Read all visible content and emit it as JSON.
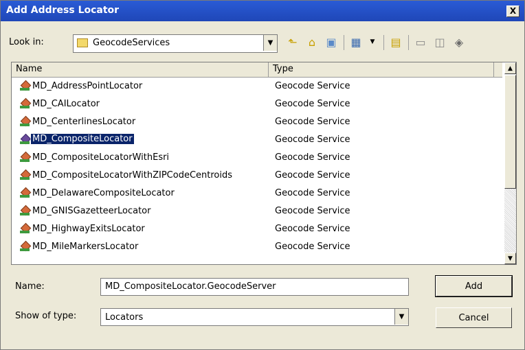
{
  "window": {
    "title": "Add Address Locator",
    "close_label": "X"
  },
  "lookin": {
    "label": "Look in:",
    "value": "GeocodeServices"
  },
  "toolbar": {
    "icons": [
      "up-one-level-icon",
      "home-icon",
      "connect-folder-icon",
      "details-view-icon",
      "new-folder-icon",
      "catalog-icon",
      "new-item-icon",
      "database-icon"
    ]
  },
  "list": {
    "columns": [
      "Name",
      "Type"
    ],
    "rows": [
      {
        "name": "MD_AddressPointLocator",
        "type": "Geocode Service"
      },
      {
        "name": "MD_CAILocator",
        "type": "Geocode Service"
      },
      {
        "name": "MD_CenterlinesLocator",
        "type": "Geocode Service"
      },
      {
        "name": "MD_CompositeLocator",
        "type": "Geocode Service",
        "selected": true
      },
      {
        "name": "MD_CompositeLocatorWithEsri",
        "type": "Geocode Service"
      },
      {
        "name": "MD_CompositeLocatorWithZIPCodeCentroids",
        "type": "Geocode Service"
      },
      {
        "name": "MD_DelawareCompositeLocator",
        "type": "Geocode Service"
      },
      {
        "name": "MD_GNISGazetteerLocator",
        "type": "Geocode Service"
      },
      {
        "name": "MD_HighwayExitsLocator",
        "type": "Geocode Service"
      },
      {
        "name": "MD_MileMarkersLocator",
        "type": "Geocode Service"
      }
    ]
  },
  "form": {
    "name_label": "Name:",
    "name_value": "MD_CompositeLocator.GeocodeServer",
    "type_label": "Show of type:",
    "type_value": "Locators"
  },
  "buttons": {
    "add": "Add",
    "cancel": "Cancel"
  }
}
